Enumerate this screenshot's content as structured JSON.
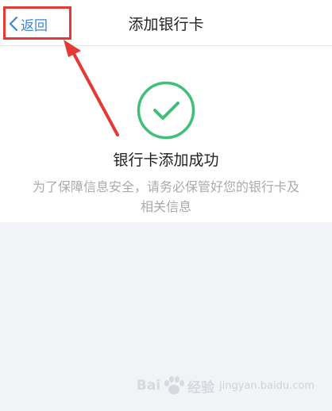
{
  "navbar": {
    "back_label": "返回",
    "title": "添加银行卡"
  },
  "result": {
    "icon": "check-circle-icon",
    "title": "银行卡添加成功",
    "description": "为了保障信息安全，请务必保管好您的银行卡及相关信息"
  },
  "watermark": {
    "text_left": "Bai",
    "text_right": "经验",
    "sub": "jingyan.baidu.com"
  },
  "colors": {
    "accent_blue": "#3a87d6",
    "success_green": "#3fbf78",
    "annotation_red": "#e53935",
    "background": "#f2f3f6"
  }
}
